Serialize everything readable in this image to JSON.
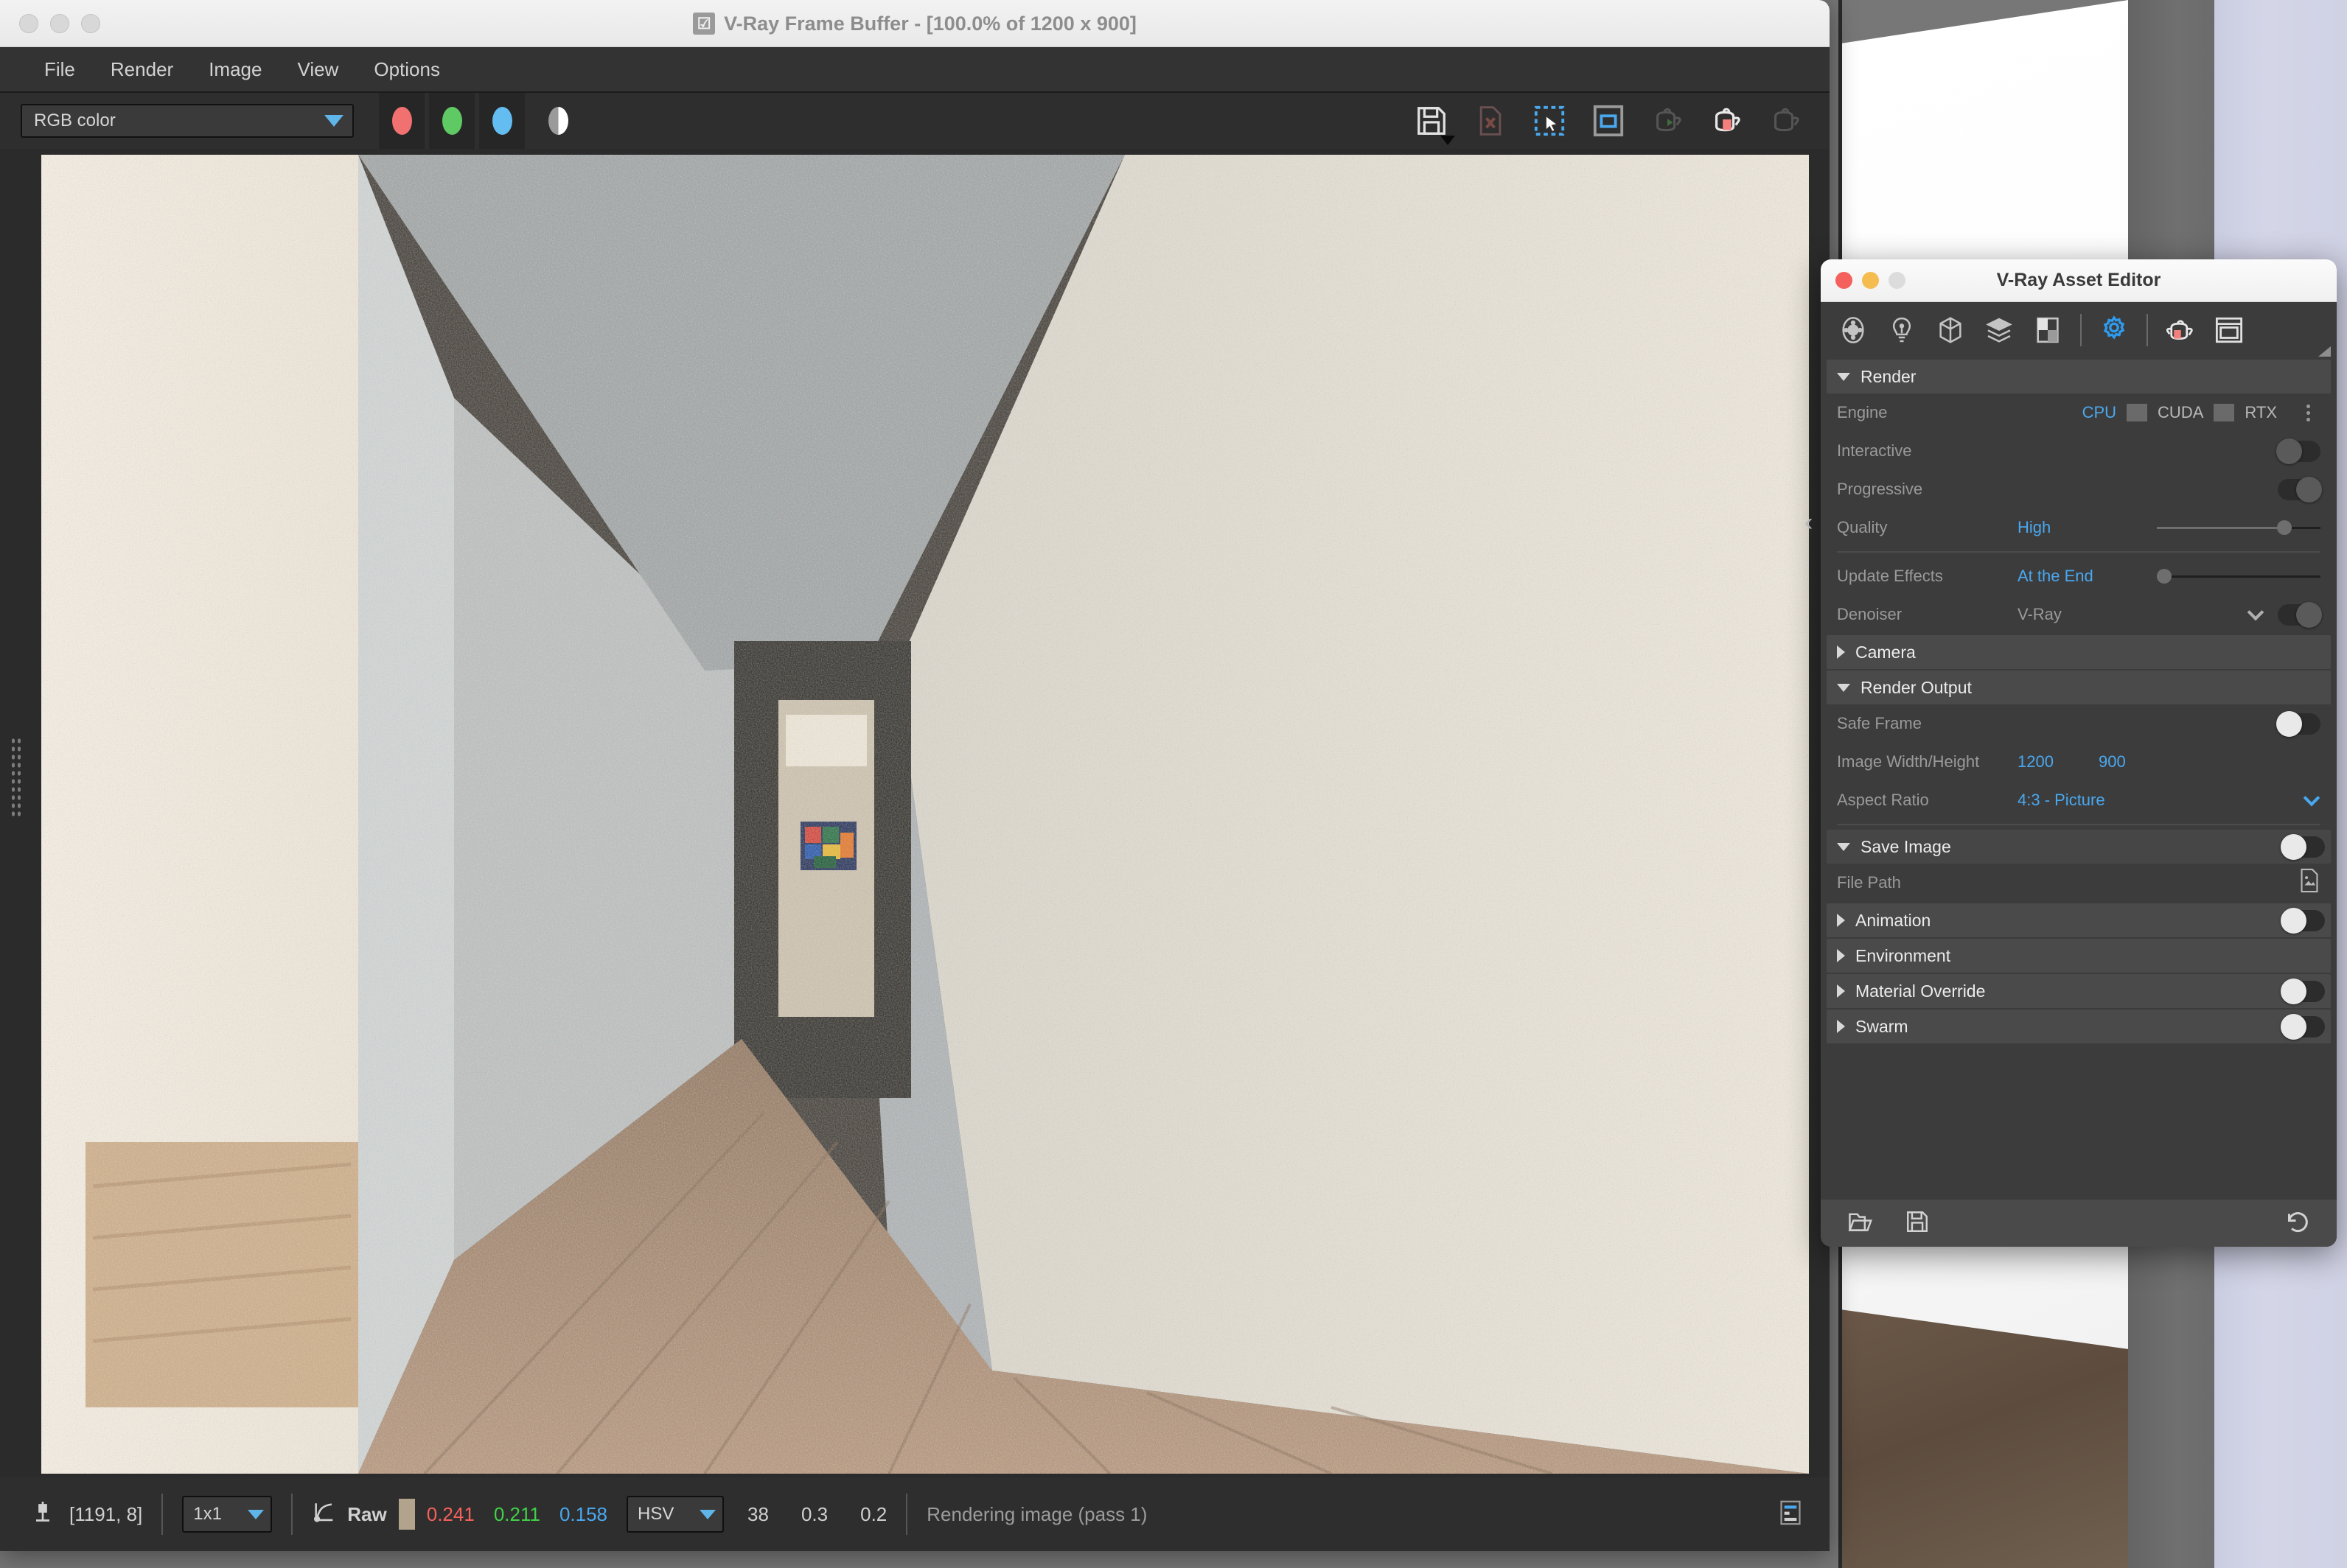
{
  "vfb": {
    "title": "V-Ray Frame Buffer - [100.0% of 1200 x 900]",
    "badge_icon": "vray-check-icon",
    "menu": [
      {
        "label": "File"
      },
      {
        "label": "Render"
      },
      {
        "label": "Image"
      },
      {
        "label": "View"
      },
      {
        "label": "Options"
      }
    ],
    "toolbar": {
      "channel_value": "RGB color",
      "channels": [
        {
          "name": "red-channel",
          "color": "#f0716f"
        },
        {
          "name": "green-channel",
          "color": "#5fca64"
        },
        {
          "name": "blue-channel",
          "color": "#63bdf0"
        }
      ],
      "alpha_icon": "alpha-channel-icon",
      "icons": [
        {
          "name": "save-image-icon",
          "label": "Save image"
        },
        {
          "name": "clear-image-icon",
          "label": "Clear image"
        },
        {
          "name": "region-render-icon",
          "label": "Render region"
        },
        {
          "name": "track-mouse-icon",
          "label": "Follow mouse"
        },
        {
          "name": "render-last-icon",
          "label": "Render last"
        },
        {
          "name": "render-stop-icon",
          "label": "Stop render"
        },
        {
          "name": "render-idle-icon",
          "label": "Render"
        }
      ]
    },
    "status": {
      "pixel_icon": "pixel-probe-icon",
      "coords": "[1191, 8]",
      "zoom": "1x1",
      "curve_icon": "color-curve-icon",
      "mode": "Raw",
      "swatch_color": "#b2a48c",
      "r": "0.241",
      "g": "0.211",
      "b": "0.158",
      "color_space": "HSV",
      "h": "38",
      "s": "0.3",
      "v": "0.2",
      "message": "Rendering image (pass 1)",
      "log_icon": "render-log-icon"
    }
  },
  "asset_editor": {
    "title": "V-Ray Asset Editor",
    "toolbar": [
      {
        "name": "materials-icon",
        "active": false
      },
      {
        "name": "lights-icon",
        "active": false
      },
      {
        "name": "geometry-icon",
        "active": false
      },
      {
        "name": "render-elements-icon",
        "active": false
      },
      {
        "name": "textures-icon",
        "active": false
      },
      {
        "name": "settings-gear-icon",
        "active": true
      },
      {
        "name": "render-teapot-icon",
        "active": false
      },
      {
        "name": "frame-buffer-icon",
        "active": false
      }
    ],
    "sections": {
      "render": {
        "label": "Render",
        "expanded": true,
        "engine": {
          "label": "Engine",
          "options": [
            "CPU",
            "CUDA",
            "RTX"
          ],
          "selected": "CPU",
          "menu_icon": "kebab-menu-icon"
        },
        "interactive": {
          "label": "Interactive",
          "enabled": false
        },
        "progressive": {
          "label": "Progressive",
          "enabled": true
        },
        "quality": {
          "label": "Quality",
          "value": "High",
          "slider_pct": 78
        },
        "update_effects": {
          "label": "Update Effects",
          "value": "At the End",
          "slider_pct": 3
        },
        "denoiser": {
          "label": "Denoiser",
          "value": "V-Ray",
          "enabled": true
        }
      },
      "camera": {
        "label": "Camera",
        "expanded": false
      },
      "render_output": {
        "label": "Render Output",
        "expanded": true,
        "safe_frame": {
          "label": "Safe Frame",
          "enabled": false
        },
        "image_size": {
          "label": "Image Width/Height",
          "width": "1200",
          "height": "900"
        },
        "aspect_ratio": {
          "label": "Aspect Ratio",
          "value": "4:3 - Picture"
        },
        "save_image": {
          "label": "Save Image",
          "enabled": false
        },
        "file_path": {
          "label": "File Path",
          "value": "",
          "browse_icon": "file-browse-icon"
        }
      },
      "animation": {
        "label": "Animation",
        "expanded": false,
        "enabled": false
      },
      "environment": {
        "label": "Environment",
        "expanded": false
      },
      "material_override": {
        "label": "Material Override",
        "expanded": false,
        "enabled": false
      },
      "swarm": {
        "label": "Swarm",
        "expanded": false,
        "enabled": false
      }
    },
    "bottom_bar": [
      {
        "name": "open-file-icon"
      },
      {
        "name": "save-file-icon"
      },
      {
        "name": "revert-icon"
      }
    ],
    "collapse_left_icon": "chevron-left-icon",
    "collapse_right_icon": "chevron-right-icon"
  }
}
